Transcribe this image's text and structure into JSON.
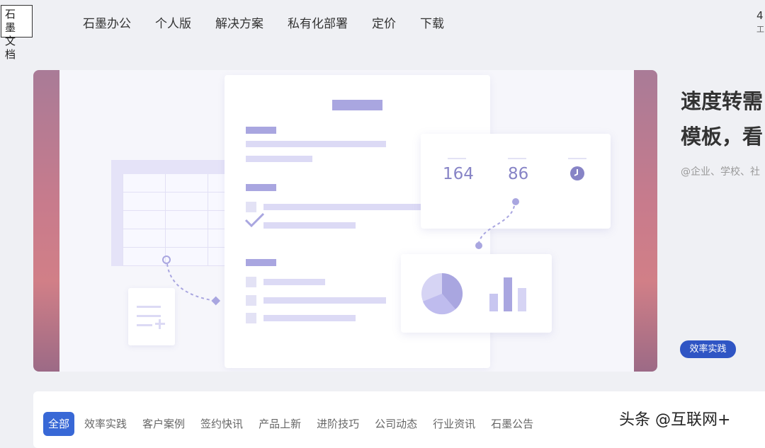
{
  "logo": {
    "line1": "石 墨",
    "line2": "文 档"
  },
  "nav": {
    "items": [
      "石墨办公",
      "个人版",
      "解决方案",
      "私有化部署",
      "定价",
      "下载"
    ]
  },
  "header_right": {
    "text": "4",
    "sub": "工"
  },
  "banner": {
    "stats": [
      "164",
      "86"
    ],
    "headline_line1": "速度转需",
    "headline_line2": "模板，看",
    "subtext": "@企业、学校、社",
    "badge": "效率实践"
  },
  "tabs": [
    "全部",
    "效率实践",
    "客户案例",
    "签约快讯",
    "产品上新",
    "进阶技巧",
    "公司动态",
    "行业资讯",
    "石墨公告"
  ],
  "watermark": "头条 @互联网+",
  "colors": {
    "accent": "#3868d6",
    "badge": "#2f55c4",
    "illustration": "#a9a6e0"
  }
}
